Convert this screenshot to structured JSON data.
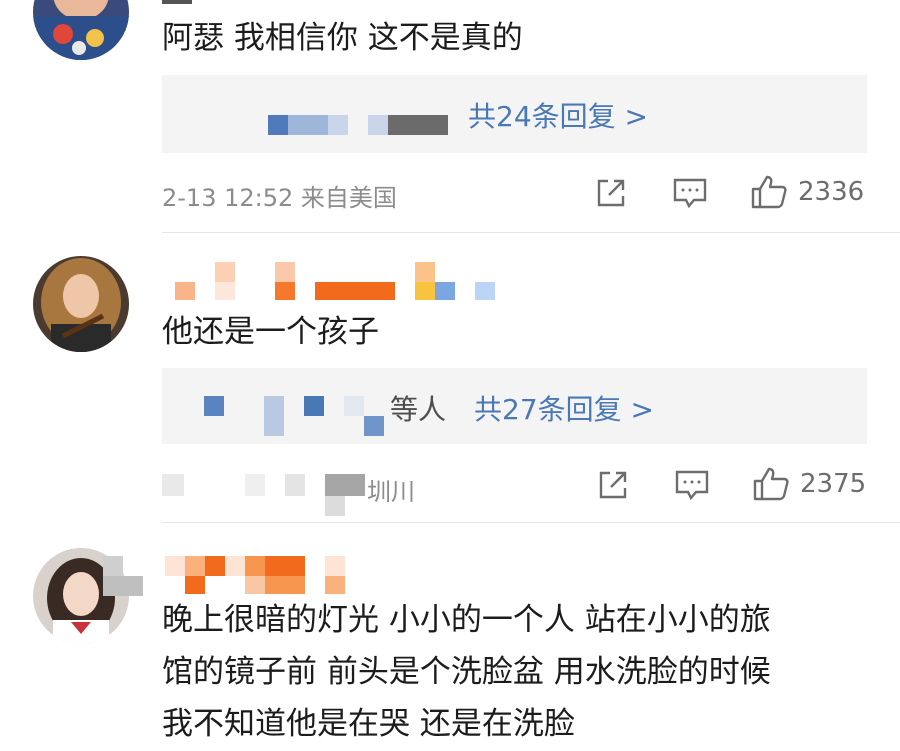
{
  "comments": [
    {
      "text": "阿瑟 我相信你 这不是真的",
      "reply_link": "共24条回复 >",
      "meta": "2-13 12:52 来自美国",
      "likes": "2336",
      "icons": [
        "share-icon",
        "comment-icon",
        "like-icon"
      ]
    },
    {
      "text": "他还是一个孩子",
      "reply_prefix": "等人",
      "reply_link": "共27条回复 >",
      "meta_fragment": "圳川",
      "likes": "2375",
      "icons": [
        "share-icon",
        "comment-icon",
        "like-icon"
      ]
    },
    {
      "text_lines": [
        "晚上很暗的灯光 小小的一个人 站在小小的旅",
        "馆的镜子前 前头是个洗脸盆 用水洗脸的时候",
        "我不知道他是在哭 还是在洗脸"
      ]
    }
  ],
  "colors": {
    "link": "#4a78b5",
    "reply_bg": "#f4f4f4",
    "meta": "#8c8c8c"
  }
}
